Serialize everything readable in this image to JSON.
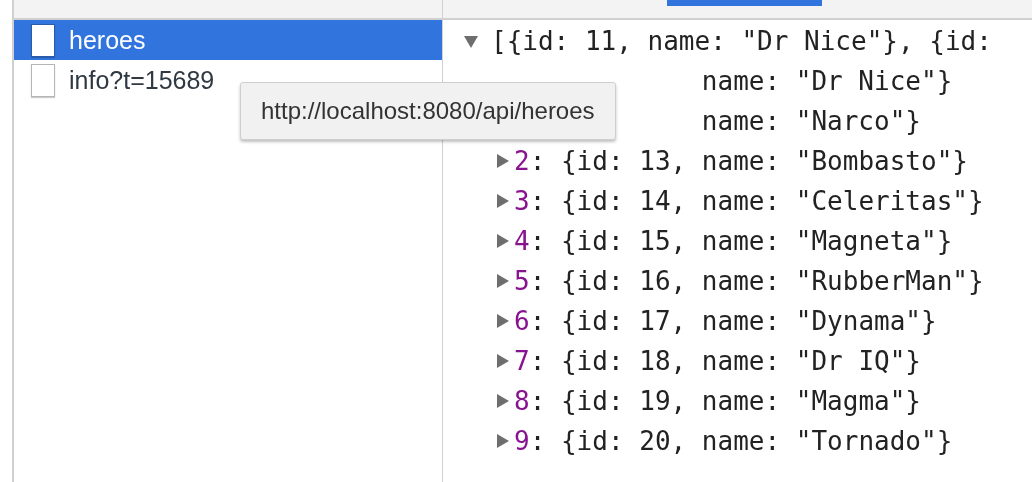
{
  "requests": [
    {
      "name": "heroes",
      "selected": true
    },
    {
      "name": "info?t=15689",
      "selected": false
    }
  ],
  "tooltip": {
    "text": "http://localhost:8080/api/heroes"
  },
  "preview": {
    "summary": "[{id: 11, name: \"Dr Nice\"}, {id:",
    "expanded": true,
    "items": [
      {
        "kind": "partial",
        "value": "name: \"Dr Nice\"}"
      },
      {
        "kind": "partial",
        "value": "name: \"Narco\"}"
      },
      {
        "kind": "entry",
        "index": "2",
        "value": ": {id: 13, name: \"Bombasto\"}",
        "expanded": false
      },
      {
        "kind": "entry",
        "index": "3",
        "value": ": {id: 14, name: \"Celeritas\"}",
        "expanded": false
      },
      {
        "kind": "entry",
        "index": "4",
        "value": ": {id: 15, name: \"Magneta\"}",
        "expanded": false
      },
      {
        "kind": "entry",
        "index": "5",
        "value": ": {id: 16, name: \"RubberMan\"}",
        "expanded": false
      },
      {
        "kind": "entry",
        "index": "6",
        "value": ": {id: 17, name: \"Dynama\"}",
        "expanded": false
      },
      {
        "kind": "entry",
        "index": "7",
        "value": ": {id: 18, name: \"Dr IQ\"}",
        "expanded": false
      },
      {
        "kind": "entry",
        "index": "8",
        "value": ": {id: 19, name: \"Magma\"}",
        "expanded": false
      },
      {
        "kind": "entry",
        "index": "9",
        "value": ": {id: 20, name: \"Tornado\"}",
        "expanded": false
      }
    ]
  }
}
